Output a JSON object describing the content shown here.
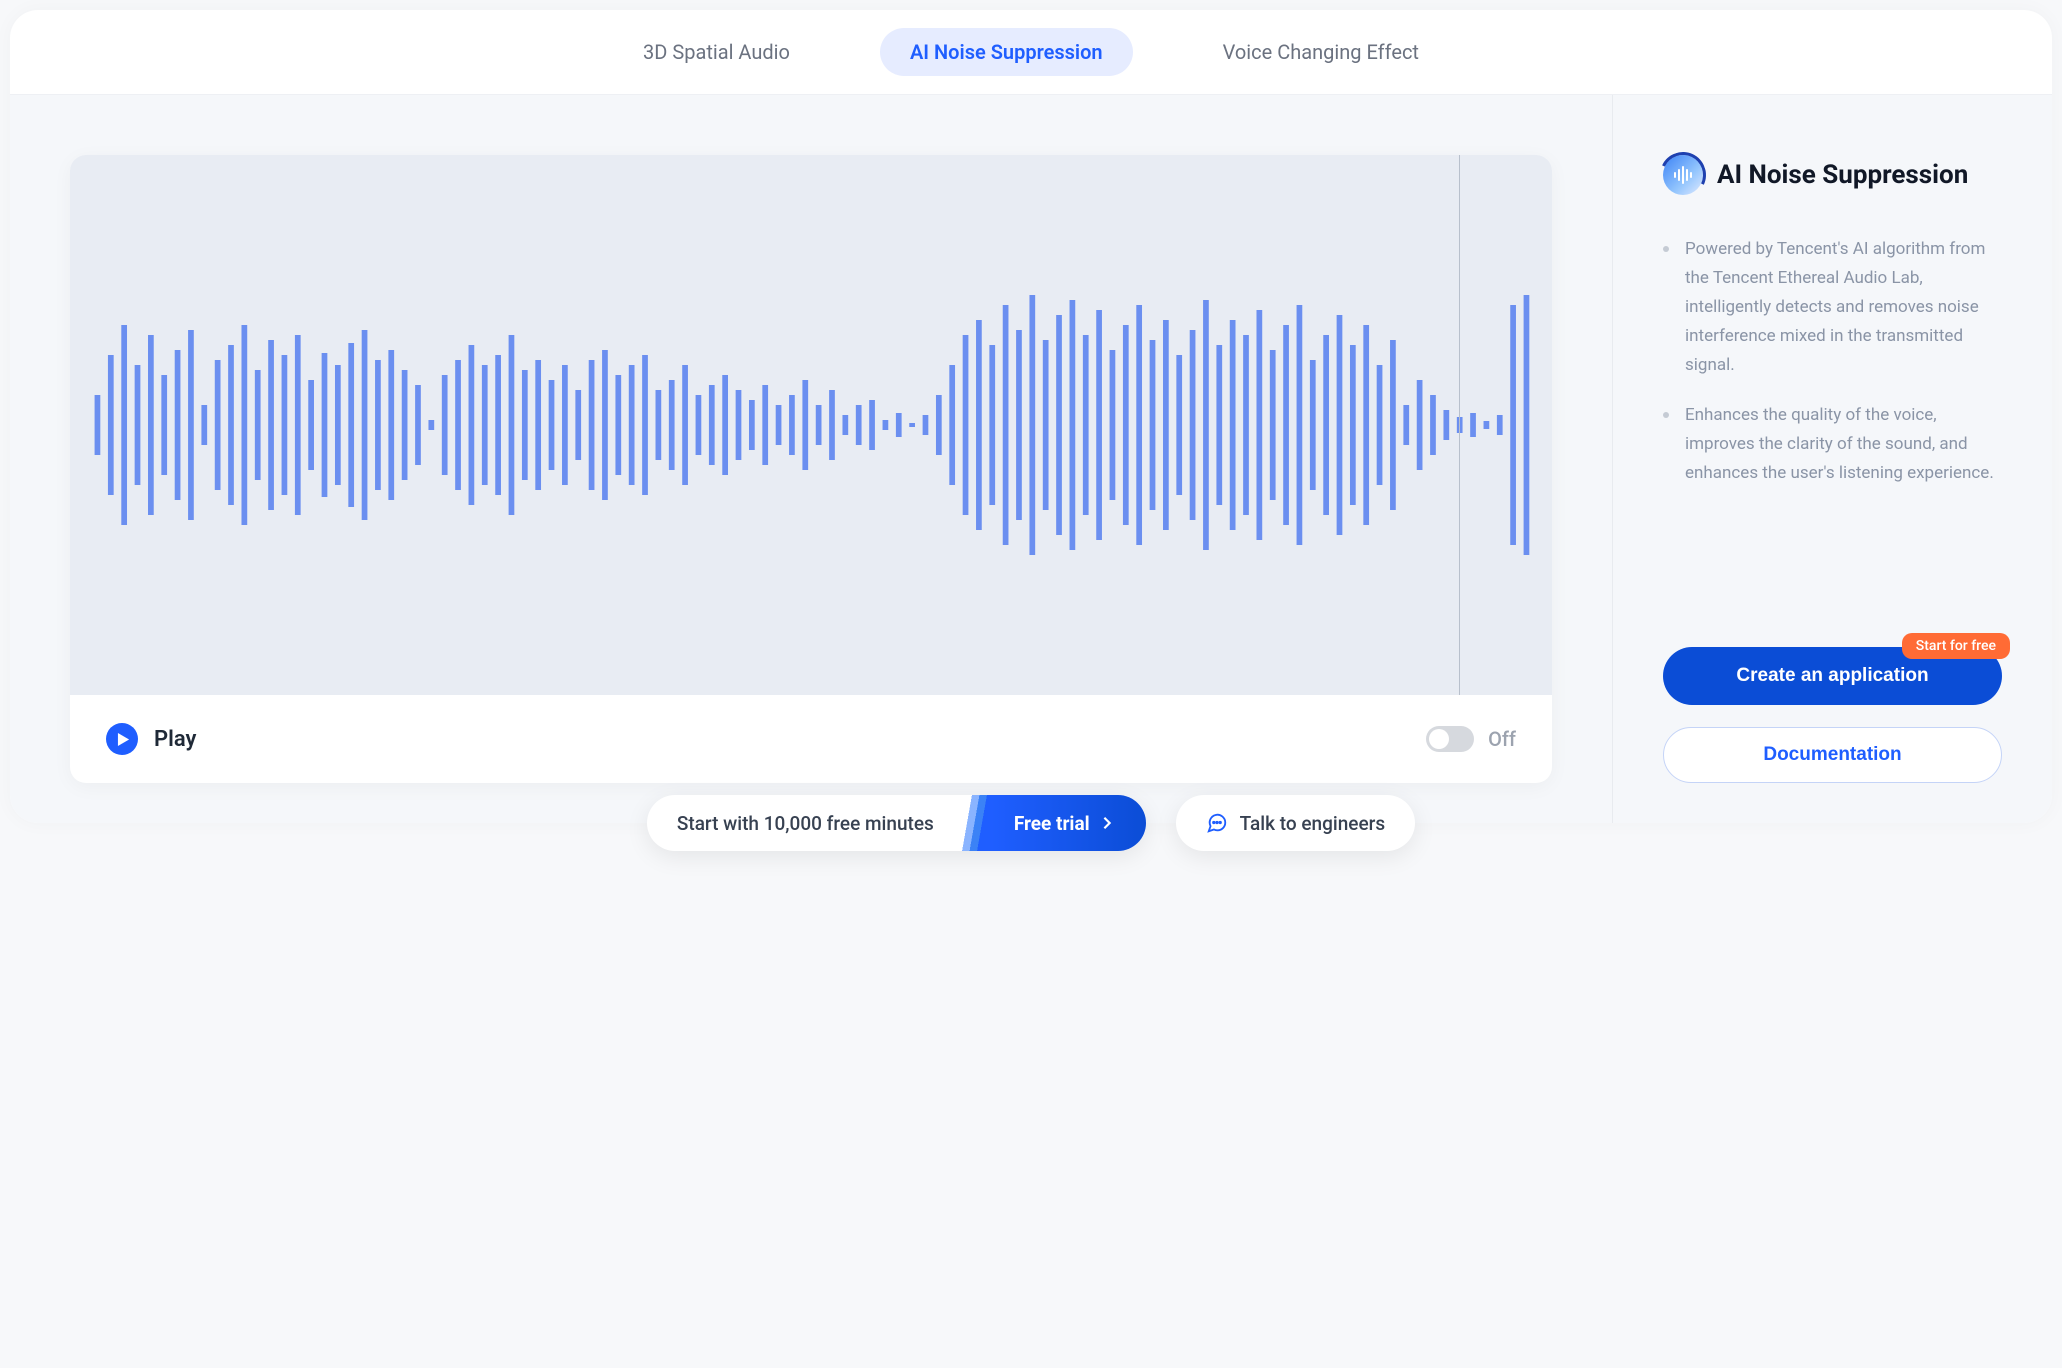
{
  "tabs": [
    {
      "label": "3D Spatial Audio",
      "active": false
    },
    {
      "label": "AI Noise Suppression",
      "active": true
    },
    {
      "label": "Voice Changing Effect",
      "active": false
    }
  ],
  "player": {
    "play_label": "Play",
    "toggle_label": "Off"
  },
  "sidebar": {
    "title": "AI Noise Suppression",
    "features": [
      "Powered by Tencent's AI algorithm from the Tencent Ethereal Audio Lab, intelligently detects and removes noise interference mixed in the transmitted signal.",
      "Enhances the quality of the voice, improves the clarity of the sound, and enhances the user's listening experience."
    ],
    "badge": "Start for free",
    "create_label": "Create an application",
    "docs_label": "Documentation"
  },
  "bottom": {
    "minutes_text": "Start with 10,000 free minutes",
    "trial_label": "Free trial",
    "talk_label": "Talk to engineers"
  }
}
